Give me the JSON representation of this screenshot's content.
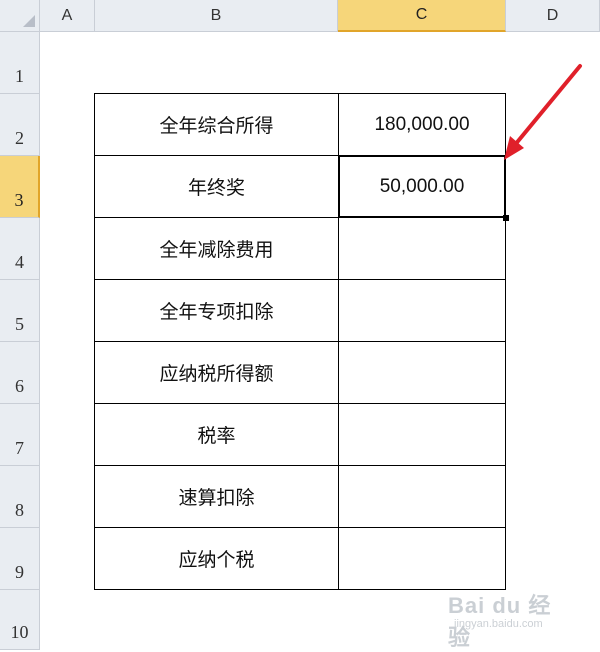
{
  "columns": [
    "A",
    "B",
    "C",
    "D"
  ],
  "rows": [
    "1",
    "2",
    "3",
    "4",
    "5",
    "6",
    "7",
    "8",
    "9",
    "10"
  ],
  "selected": {
    "column": "C",
    "row": "3"
  },
  "table": [
    {
      "label": "全年综合所得",
      "value": "180,000.00"
    },
    {
      "label": "年终奖",
      "value": "50,000.00"
    },
    {
      "label": "全年减除费用",
      "value": ""
    },
    {
      "label": "全年专项扣除",
      "value": ""
    },
    {
      "label": "应纳税所得额",
      "value": ""
    },
    {
      "label": "税率",
      "value": ""
    },
    {
      "label": "速算扣除",
      "value": ""
    },
    {
      "label": "应纳个税",
      "value": ""
    }
  ],
  "annotation": {
    "arrow_color": "#e0202a"
  },
  "watermark": {
    "logo": "Bai du 经验",
    "url": "jingyan.baidu.com"
  }
}
